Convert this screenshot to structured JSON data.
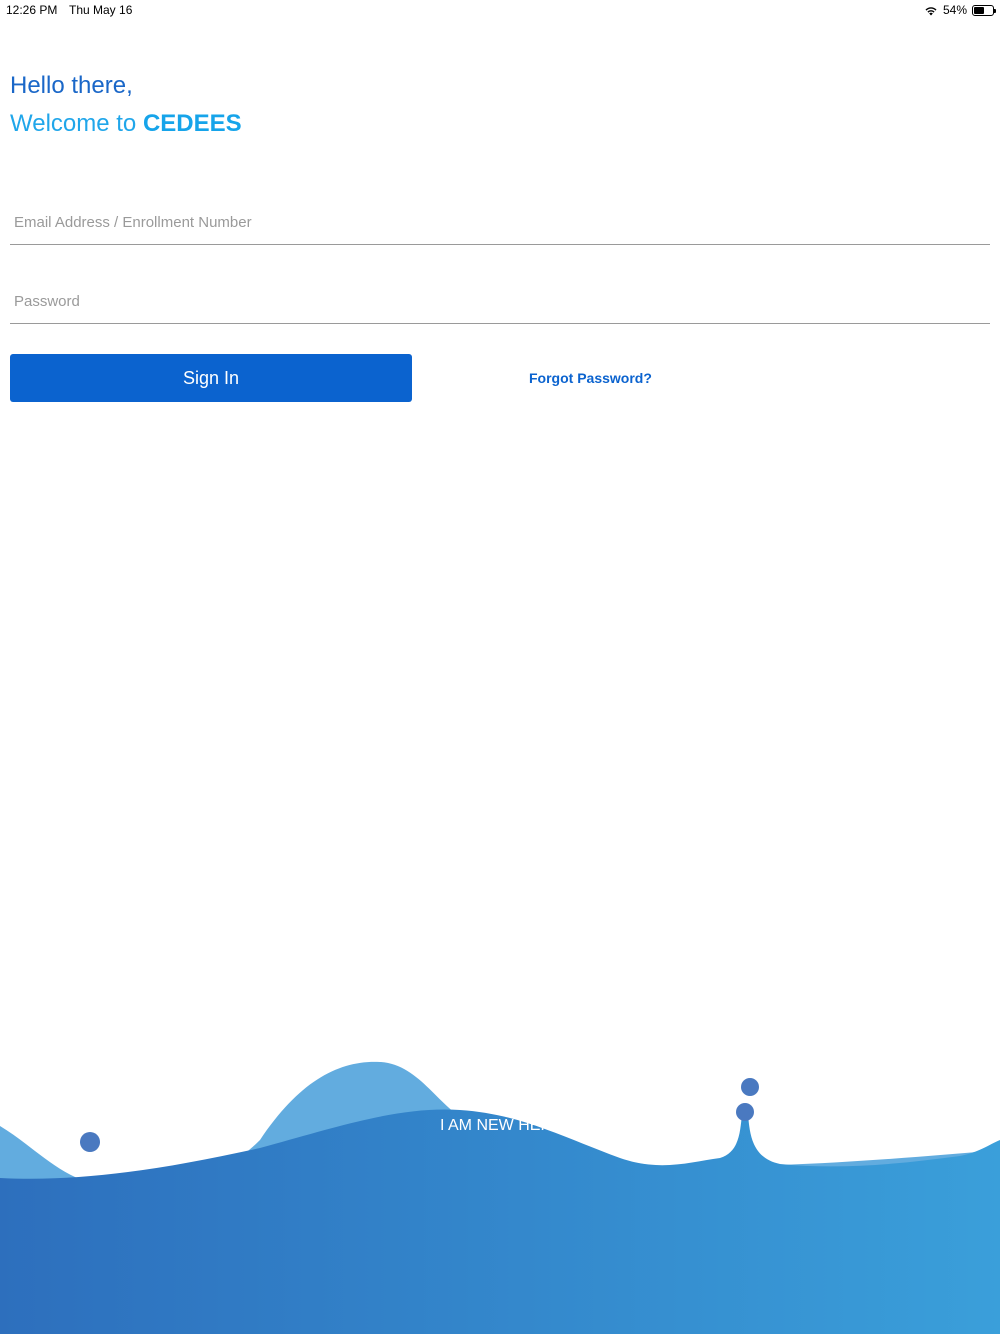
{
  "status_bar": {
    "time": "12:26 PM",
    "date": "Thu May 16",
    "battery": "54%",
    "battery_level": 0.54
  },
  "header": {
    "greeting": "Hello there,",
    "welcome_prefix": "Welcome to ",
    "brand": "CEDEES"
  },
  "form": {
    "email_placeholder": "Email Address / Enrollment Number",
    "email_value": "",
    "password_placeholder": "Password",
    "password_value": "",
    "sign_in_label": "Sign In",
    "forgot_label": "Forgot Password?"
  },
  "footer": {
    "new_here_label": "I AM NEW HERE"
  },
  "colors": {
    "primary": "#0b63cf",
    "accent": "#16a4ea",
    "wave_dark": "#2f7fc4",
    "wave_light": "#5aa8e0"
  },
  "icons": {
    "wifi": "wifi-icon",
    "battery": "battery-icon"
  }
}
